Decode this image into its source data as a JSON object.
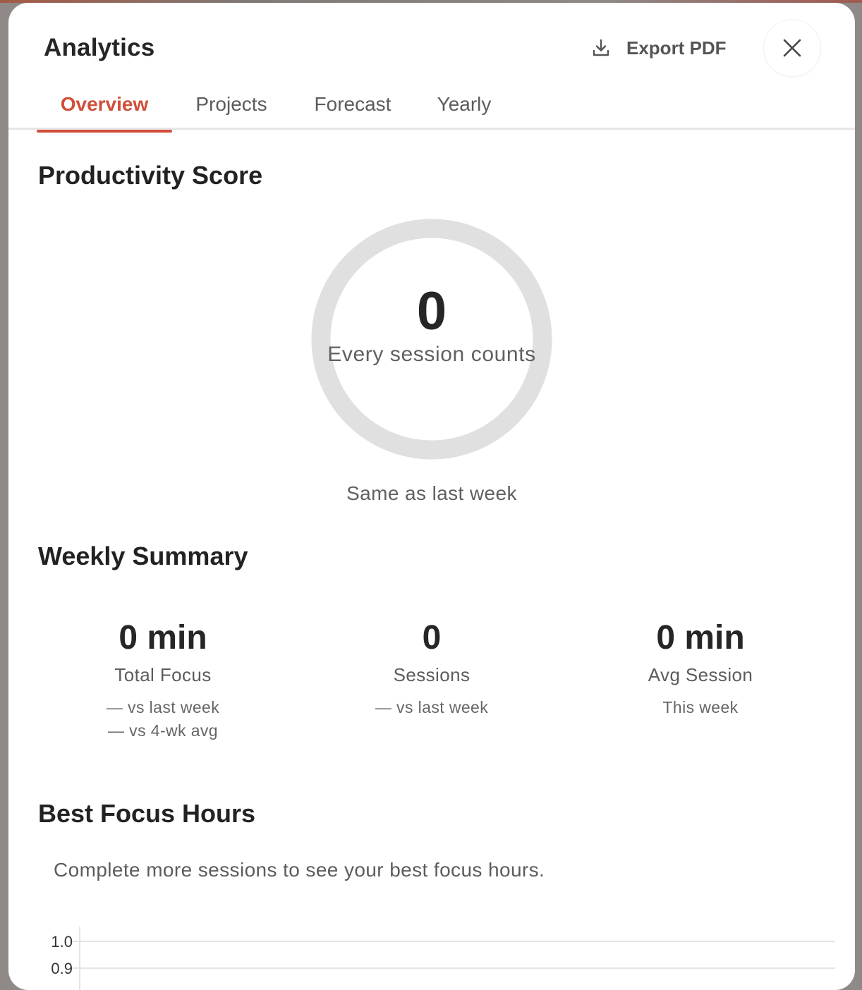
{
  "header": {
    "title": "Analytics",
    "export_label": "Export PDF",
    "export_icon": "download-icon",
    "close_icon": "close-icon"
  },
  "tabs": [
    {
      "label": "Overview",
      "active": true
    },
    {
      "label": "Projects",
      "active": false
    },
    {
      "label": "Forecast",
      "active": false
    },
    {
      "label": "Yearly",
      "active": false
    }
  ],
  "productivity": {
    "title": "Productivity Score",
    "score": "0",
    "caption": "Every session counts",
    "comparison": "Same as last week"
  },
  "weekly": {
    "title": "Weekly Summary",
    "stats": [
      {
        "value": "0 min",
        "label": "Total Focus",
        "sub": [
          "— vs last week",
          "— vs 4-wk avg"
        ]
      },
      {
        "value": "0",
        "label": "Sessions",
        "sub": [
          "— vs last week"
        ]
      },
      {
        "value": "0 min",
        "label": "Avg Session",
        "sub": [
          "This week"
        ]
      }
    ]
  },
  "best_hours": {
    "title": "Best Focus Hours",
    "empty_message": "Complete more sessions to see your best focus hours."
  },
  "colors": {
    "accent": "#d14f3a",
    "ring": "#e0e0e0",
    "text_primary": "#262626",
    "text_secondary": "#5c5c5c"
  },
  "chart_data": {
    "type": "bar",
    "categories": [],
    "values": [],
    "y_ticks": [
      "1.0",
      "0.9"
    ],
    "ylim": [
      0,
      1.0
    ],
    "grid": true
  }
}
